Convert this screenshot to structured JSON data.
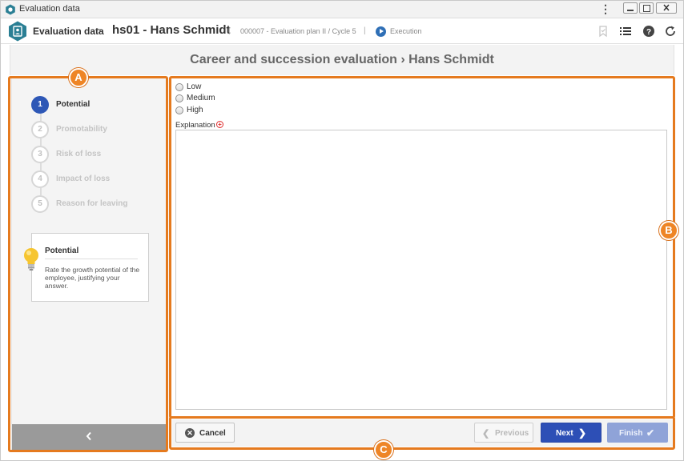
{
  "window": {
    "title": "Evaluation data",
    "menu_glyph": "⋮"
  },
  "header": {
    "app_title": "Evaluation data",
    "separator": "›",
    "record": "hs01 - Hans Schmidt",
    "pipe": "|",
    "plan": "000007 - Evaluation plan II / Cycle 5",
    "status": "Execution",
    "tools": [
      "bookmark-icon",
      "list-icon",
      "help-icon",
      "refresh-icon"
    ]
  },
  "page": {
    "title": "Career and succession evaluation › Hans Schmidt"
  },
  "steps": [
    {
      "number": "1",
      "label": "Potential",
      "active": true
    },
    {
      "number": "2",
      "label": "Promotability",
      "active": false
    },
    {
      "number": "3",
      "label": "Risk of loss",
      "active": false
    },
    {
      "number": "4",
      "label": "Impact of loss",
      "active": false
    },
    {
      "number": "5",
      "label": "Reason for leaving",
      "active": false
    }
  ],
  "info": {
    "title": "Potential",
    "description": "Rate the growth potential of the employee, justifying your answer."
  },
  "form": {
    "options": [
      "Low",
      "Medium",
      "High"
    ],
    "explanation_label": "Explanation",
    "required_glyph": "+",
    "explanation_value": ""
  },
  "footer": {
    "cancel": "Cancel",
    "previous": "Previous",
    "next": "Next",
    "finish": "Finish"
  },
  "annotations": {
    "a": "A",
    "b": "B",
    "c": "C"
  },
  "colors": {
    "accent": "#2d57b6",
    "callout": "#e57a1e",
    "required": "#e03030",
    "collapse_bar": "#9a9a9a"
  }
}
